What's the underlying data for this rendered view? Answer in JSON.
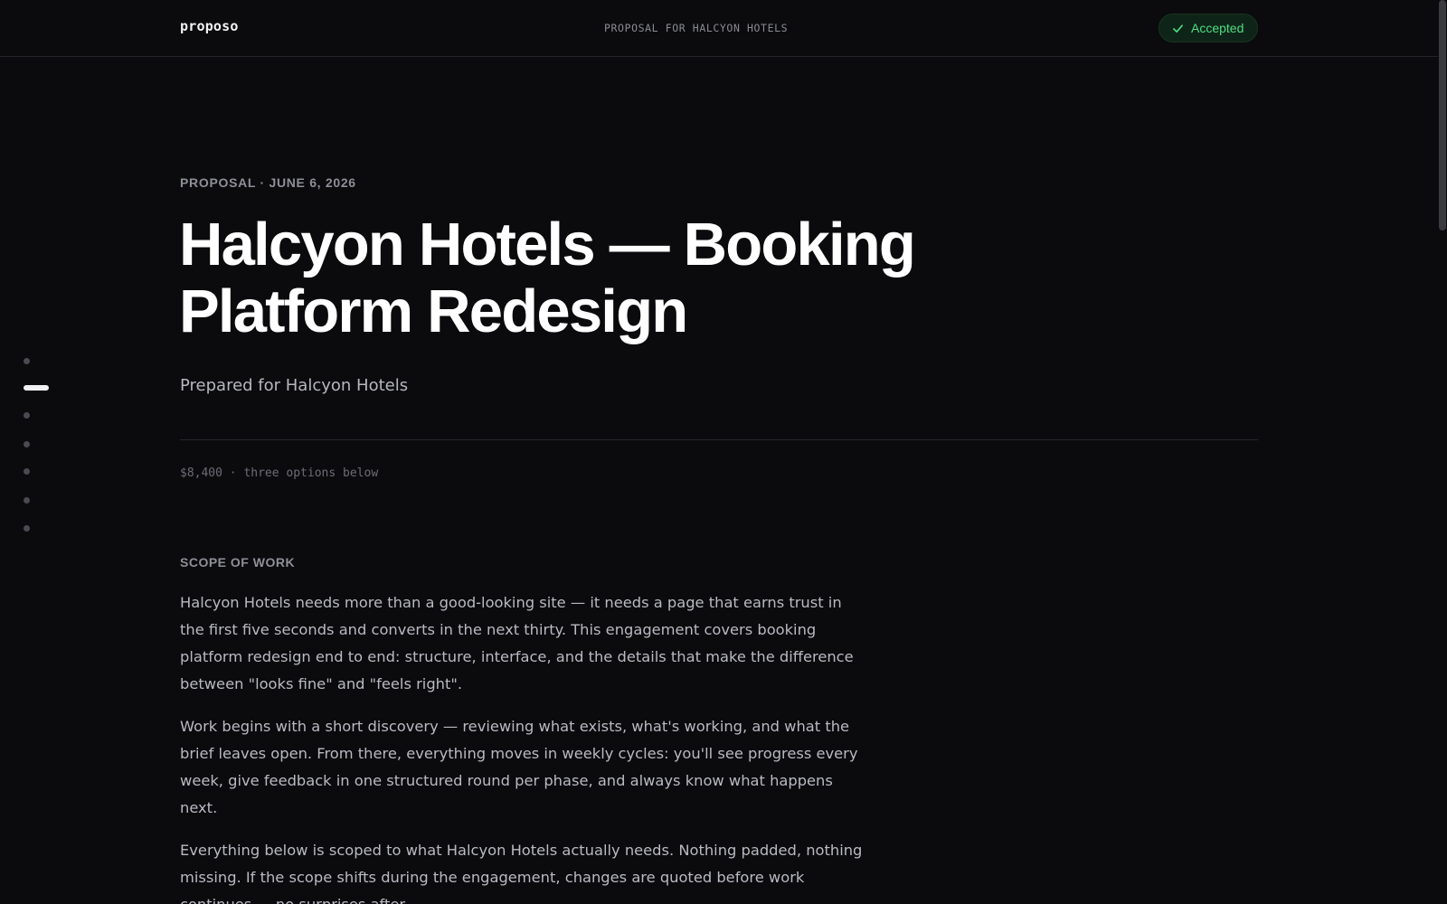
{
  "header": {
    "brand": "proposo",
    "center_label": "PROPOSAL FOR HALCYON HOTELS",
    "status": {
      "label": "Accepted",
      "icon": "check-icon",
      "color": "#4ade80"
    }
  },
  "nav": {
    "dots": [
      {
        "label": "",
        "active": false
      },
      {
        "label": "",
        "active": true
      },
      {
        "label": "",
        "active": false
      },
      {
        "label": "",
        "active": false
      },
      {
        "label": "",
        "active": false
      },
      {
        "label": "",
        "active": false
      },
      {
        "label": "",
        "active": false
      }
    ]
  },
  "hero": {
    "eyebrow": "PROPOSAL · JUNE 6, 2026",
    "title": "Halcyon Hotels — Booking Platform Redesign",
    "subtitle": "Prepared for Halcyon Hotels",
    "meta": "$8,400 · three options below"
  },
  "scope": {
    "label": "SCOPE OF WORK",
    "paragraphs": [
      "Halcyon Hotels needs more than a good-looking site — it needs a page that earns trust in the first five seconds and converts in the next thirty. This engagement covers booking platform redesign end to end: structure, interface, and the details that make the difference between \"looks fine\" and \"feels right\".",
      "Work begins with a short discovery — reviewing what exists, what's working, and what the brief leaves open. From there, everything moves in weekly cycles: you'll see progress every week, give feedback in one structured round per phase, and always know what happens next.",
      "Everything below is scoped to what Halcyon Hotels actually needs. Nothing padded, nothing missing. If the scope shifts during the engagement, changes are quoted before work continues — no surprises after."
    ]
  },
  "colors": {
    "background": "#0b0b0d",
    "accent_green": "#4ade80",
    "text_primary": "#ffffff",
    "text_muted": "#8e8f97"
  }
}
